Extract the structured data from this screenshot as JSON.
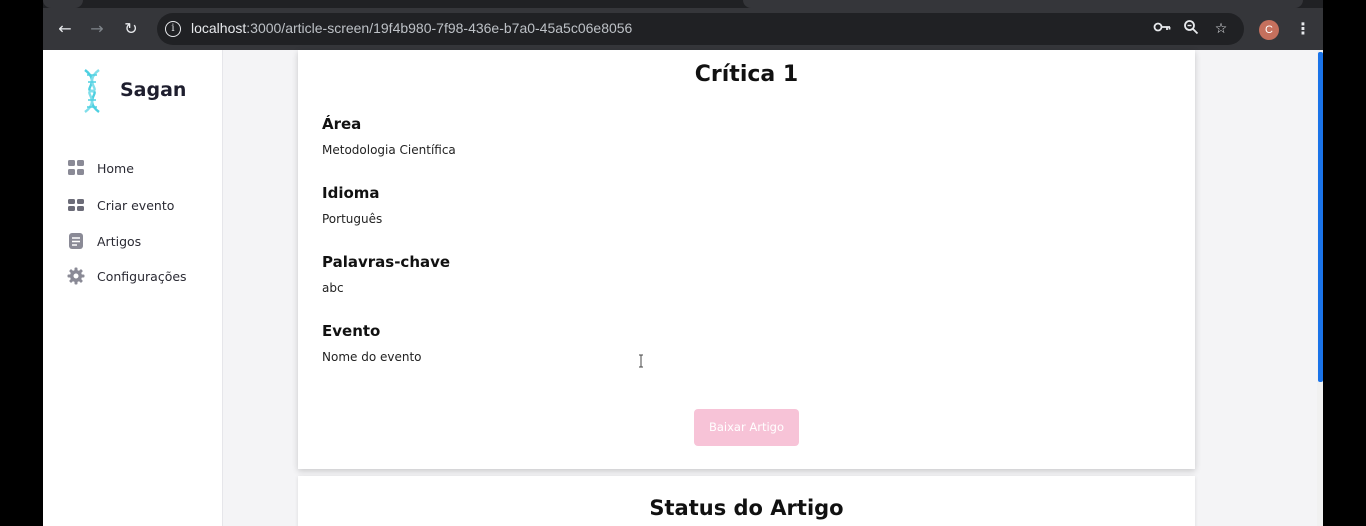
{
  "browser": {
    "url_host": "localhost",
    "url_rest": ":3000/article-screen/19f4b980-7f98-436e-b7a0-45a5c06e8056",
    "profile_initial": "C",
    "icons": [
      "back-icon",
      "forward-icon",
      "reload-icon",
      "info-icon",
      "key-icon",
      "zoom-icon",
      "star-icon",
      "menu-icon"
    ]
  },
  "sidebar": {
    "brand": "Sagan",
    "items": [
      {
        "label": "Home",
        "icon": "grid-icon"
      },
      {
        "label": "Criar evento",
        "icon": "event-icon"
      },
      {
        "label": "Artigos",
        "icon": "document-icon"
      },
      {
        "label": "Configurações",
        "icon": "gear-icon"
      }
    ]
  },
  "article": {
    "title": "Crítica 1",
    "fields": [
      {
        "label": "Área",
        "value": "Metodologia Científica"
      },
      {
        "label": "Idioma",
        "value": "Português"
      },
      {
        "label": "Palavras-chave",
        "value": "abc"
      },
      {
        "label": "Evento",
        "value": "Nome do evento"
      }
    ],
    "download_label": "Baixar Artigo"
  },
  "status": {
    "title": "Status do Artigo"
  },
  "colors": {
    "accent_pink": "#f7c3d7",
    "scroll_blue": "#1a73e8",
    "logo_teal": "#4dd0e1"
  }
}
